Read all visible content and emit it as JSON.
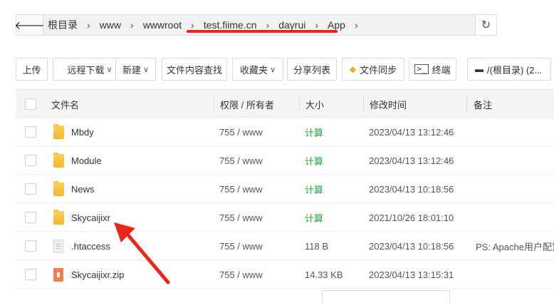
{
  "nav": {
    "back_icon": "arrow-left-icon",
    "refresh_icon": "refresh-icon",
    "breadcrumbs": [
      "根目录",
      "www",
      "wwwroot",
      "test.fiime.cn",
      "dayrui",
      "App"
    ],
    "separator": "›"
  },
  "toolbar": {
    "upload": "上传",
    "remote_download": "远程下载",
    "new": "新建",
    "content_search": "文件内容查找",
    "favorites": "收藏夹",
    "share_list": "分享列表",
    "file_sync": "文件同步",
    "terminal": "终端",
    "disk": "/(根目录) (2..."
  },
  "table": {
    "headers": {
      "name": "文件名",
      "perm": "权限 / 所有者",
      "size": "大小",
      "mtime": "修改时间",
      "note": "备注"
    },
    "rows": [
      {
        "type": "folder",
        "name": "Mbdy",
        "perm": "755 / www",
        "size": "计算",
        "mtime": "2023/04/13 13:12:46",
        "note": ""
      },
      {
        "type": "folder",
        "name": "Module",
        "perm": "755 / www",
        "size": "计算",
        "mtime": "2023/04/13 13:12:46",
        "note": ""
      },
      {
        "type": "folder",
        "name": "News",
        "perm": "755 / www",
        "size": "计算",
        "mtime": "2023/04/13 10:18:56",
        "note": ""
      },
      {
        "type": "folder",
        "name": "Skycaijixr",
        "perm": "755 / www",
        "size": "计算",
        "mtime": "2021/10/26 18:01:10",
        "note": ""
      },
      {
        "type": "file",
        "name": ".htaccess",
        "perm": "755 / www",
        "size": "118 B",
        "mtime": "2023/04/13 10:18:56",
        "note": "PS: Apache用户配置"
      },
      {
        "type": "zip",
        "name": "Skycaijixr.zip",
        "perm": "755 / www",
        "size": "14.33 KB",
        "mtime": "2023/04/13 13:15:31",
        "note": ""
      }
    ]
  },
  "colors": {
    "accent_green": "#20a53a",
    "annotation_red": "#e8271b",
    "folder_yellow": "#f6c443"
  }
}
